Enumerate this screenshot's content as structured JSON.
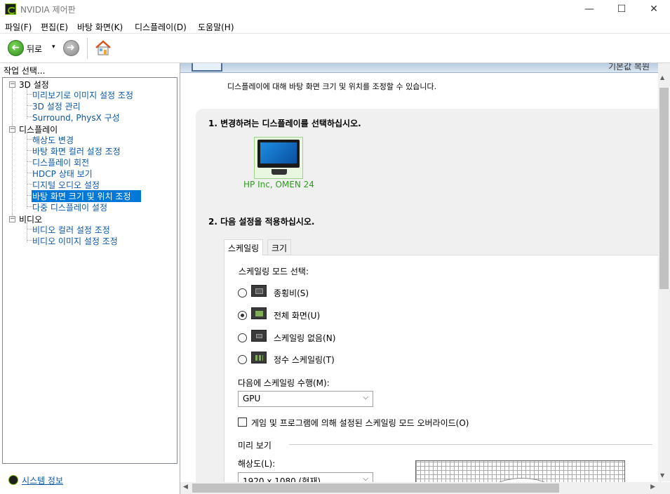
{
  "window": {
    "title": "NVIDIA 제어판",
    "minimize": "—",
    "maximize": "☐",
    "close": "✕"
  },
  "menu": [
    "파일(F)",
    "편집(E)",
    "바탕 화면(K)",
    "디스플레이(D)",
    "도움말(H)"
  ],
  "toolbar": {
    "back_label": "뒤로",
    "dropdown": "▾"
  },
  "task": {
    "label": "작업 선택..."
  },
  "tree": {
    "g1": "3D 설정",
    "g1_items": [
      "미리보기로 이미지 설정 조정",
      "3D 설정 관리",
      "Surround, PhysX 구성"
    ],
    "g2": "디스플레이",
    "g2_items": [
      "해상도 변경",
      "바탕 화면 컬러 설정 조정",
      "디스플레이 회전",
      "HDCP 상태 보기",
      "디지털 오디오 설정",
      "바탕 화면 크기 및 위치 조정",
      "다중 디스플레이 설정"
    ],
    "g3": "비디오",
    "g3_items": [
      "비디오 컬러 설정 조정",
      "비디오 이미지 설정 조정"
    ],
    "expander": "−"
  },
  "sysinfo": "시스템 정보",
  "header": {
    "restore": "기본값 복원"
  },
  "description": "디스플레이에 대해 바탕 화면 크기 및 위치를 조정할 수 있습니다.",
  "section1": "1. 변경하려는 디스플레이를 선택하십시오.",
  "monitor_label": "HP Inc, OMEN 24",
  "section2": "2. 다음 설정을 적용하십시오.",
  "tabs": [
    "스케일링",
    "크기"
  ],
  "scaling": {
    "mode_label": "스케일링 모드 선택:",
    "options": [
      {
        "label": "종횡비(S)",
        "selected": false
      },
      {
        "label": "전체 화면(U)",
        "selected": true
      },
      {
        "label": "스케일링 없음(N)",
        "selected": false
      },
      {
        "label": "정수 스케일링(T)",
        "selected": false
      }
    ],
    "perform_label": "다음에 스케일링 수행(M):",
    "perform_value": "GPU",
    "override_label": "게임 및 프로그램에 의해 설정된 스케일링 모드 오버라이드(O)",
    "preview_label": "미리 보기",
    "resolution_label": "해상도(L):",
    "resolution_value": "1920 x 1080 (현재)"
  },
  "colors": {
    "nvidia_green": "#76b900",
    "link_blue": "#0b57a8",
    "selection": "#0078d7"
  }
}
